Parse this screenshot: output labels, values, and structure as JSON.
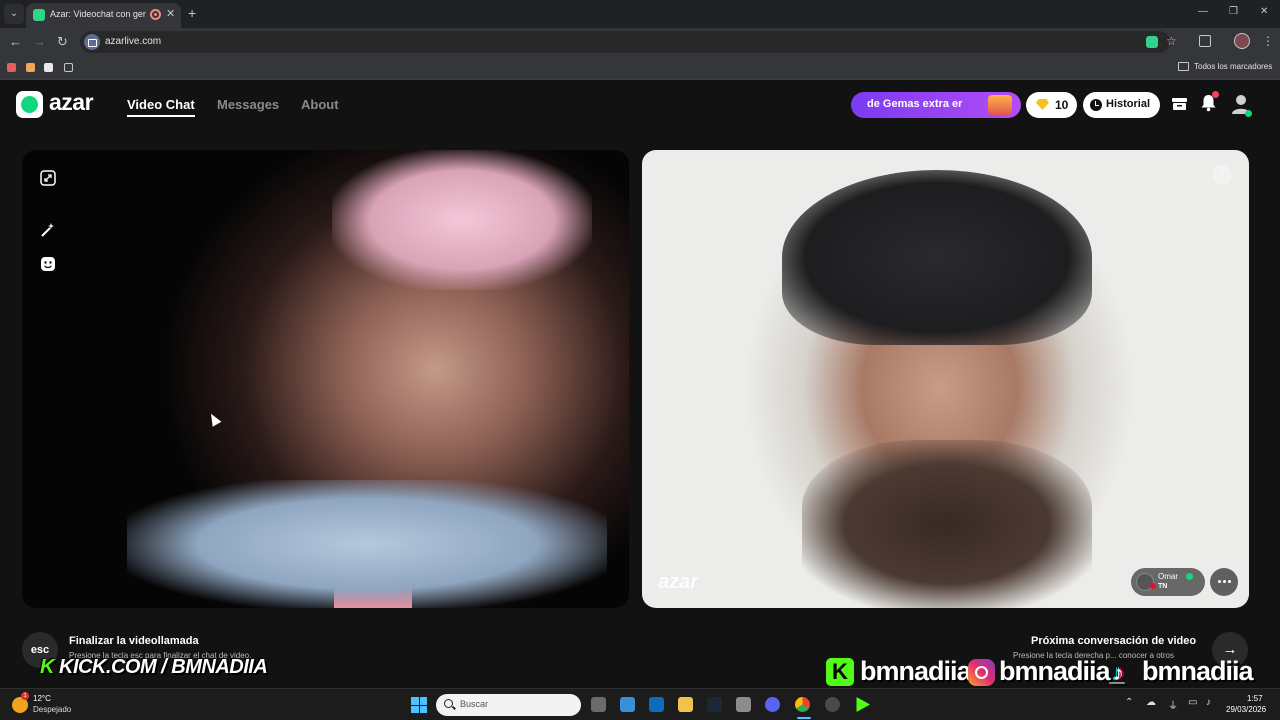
{
  "browser": {
    "tab_title": "Azar: Videochat con gente desconocida",
    "tab_close": "✕",
    "new_tab": "+",
    "url": "azarlive.com",
    "bookmarks_all": "Todos los marcadores",
    "window_minimize": "—",
    "window_restore": "❐",
    "window_close": "✕"
  },
  "header": {
    "logo": "azar",
    "nav": [
      "Video Chat",
      "Messages",
      "About"
    ],
    "promo_text": "de Gemas extra er",
    "gem_count": "10",
    "history_label": "Historial",
    "notification_count": "1"
  },
  "remote": {
    "watermark": "azar",
    "report_icon": "!",
    "user_name": "Omar",
    "user_country": "TN"
  },
  "footer": {
    "esc_label": "esc",
    "end_title": "Finalizar la videollamada",
    "end_hint": "Presione la tecla esc para finalizar el chat de video.",
    "next_title": "Próxima conversación de video",
    "next_hint": "Presione la tecla derecha p... conocer a otros",
    "next_arrow": "→"
  },
  "overlay": {
    "kick_k": "K",
    "kick_text": "KICK.COM / BMNADIIA",
    "social_kick_letter": "K",
    "handle_kick": "bmnadiia",
    "handle_instagram": "bmnadiia_",
    "handle_tiktok": "bmnadiia",
    "tiktok_glyph": "♪"
  },
  "taskbar": {
    "temperature": "12°C",
    "weather": "Despejado",
    "weather_alert": "1",
    "search_placeholder": "Buscar",
    "time": "1:57",
    "date": "29/03/2026"
  },
  "colors": {
    "brand_green": "#12d87d",
    "promo_purple": "#7b3cf2",
    "kick_green": "#53fc18"
  }
}
